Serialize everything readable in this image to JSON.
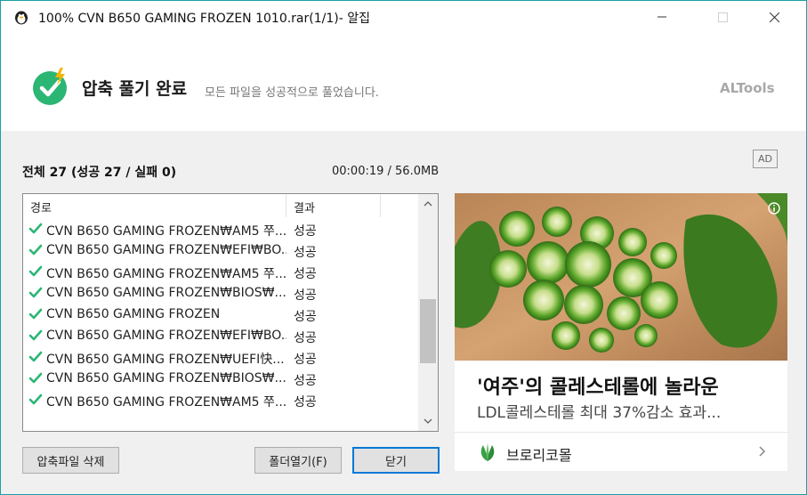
{
  "window": {
    "title": "100% CVN B650 GAMING FROZEN 1010.rar(1/1)- 알집",
    "minimize_icon": "minimize-icon",
    "maximize_icon": "maximize-icon",
    "close_icon": "close-icon"
  },
  "header": {
    "title": "압축 풀기 완료",
    "subtitle": "모든 파일을 성공적으로 풀었습니다.",
    "brand": "ALTools",
    "status_icon": "check-circle-lightning-icon"
  },
  "summary": {
    "text": "전체 27 (성공 27 / 실패 0)",
    "elapsed": "00:00:19 / 56.0MB"
  },
  "list": {
    "columns": {
      "path": "경로",
      "result": "결과"
    },
    "rows": [
      {
        "path": "CVN B650 GAMING FROZEN₩AM5 쭈...",
        "result": "성공"
      },
      {
        "path": "CVN B650 GAMING FROZEN₩EFI₩BO...",
        "result": "성공"
      },
      {
        "path": "CVN B650 GAMING FROZEN₩AM5 쭈...",
        "result": "성공"
      },
      {
        "path": "CVN B650 GAMING FROZEN₩BIOS₩...",
        "result": "성공"
      },
      {
        "path": "CVN B650 GAMING FROZEN",
        "result": "성공"
      },
      {
        "path": "CVN B650 GAMING FROZEN₩EFI₩BO...",
        "result": "성공"
      },
      {
        "path": "CVN B650 GAMING FROZEN₩UEFI快...",
        "result": "성공"
      },
      {
        "path": "CVN B650 GAMING FROZEN₩BIOS₩...",
        "result": "성공"
      },
      {
        "path": "CVN B650 GAMING FROZEN₩AM5 쭈...",
        "result": "성공"
      }
    ],
    "row_icon": "checkmark-icon",
    "scroll_position": 0.64
  },
  "buttons": {
    "delete_archive": "압축파일 삭제",
    "open_folder": "폴더열기(F)",
    "close": "닫기"
  },
  "ad": {
    "badge": "AD",
    "headline": "'여주'의 콜레스테롤에 놀라운",
    "description": "LDL콜레스테롤 최대 37%감소 효과...",
    "advertiser": "브로리코몰",
    "image_icon": "bitter-melon-photo",
    "info_icon": "info-icon",
    "logo_icon": "leaf-logo-icon",
    "chevron_icon": "chevron-right-icon"
  },
  "colors": {
    "accent": "#0078d7",
    "success_green": "#2bb673",
    "window_border": "#1aa0a8"
  }
}
